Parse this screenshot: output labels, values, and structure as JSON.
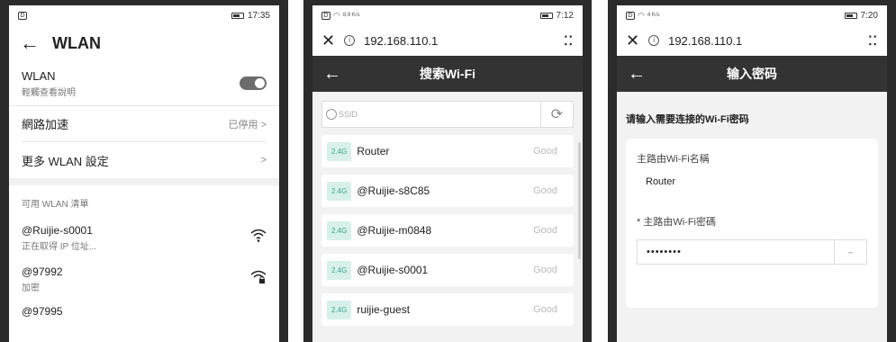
{
  "phone1": {
    "status": {
      "sim": "D",
      "time": "17:35"
    },
    "title": "WLAN",
    "wlan_row": {
      "label": "WLAN",
      "sub": "輕觸查看說明"
    },
    "accel_row": {
      "label": "網路加速",
      "value": "已停用",
      "chevron": ">"
    },
    "more_row": {
      "label": "更多 WLAN 設定",
      "chevron": ">"
    },
    "list_title": "可用 WLAN 清單",
    "networks": [
      {
        "name": "@Ruijie-s0001",
        "sub": "正在取得 IP 位址..."
      },
      {
        "name": "@97992",
        "sub": "加密"
      },
      {
        "name": "@97995",
        "sub": ""
      }
    ]
  },
  "phone2": {
    "status": {
      "sim": "D",
      "time": "7:12",
      "net": "8.9 K/s"
    },
    "url": "192.168.110.1",
    "menu": "⋮⋮",
    "page_title": "搜索Wi-Fi",
    "search_placeholder": "SSID",
    "aps": [
      {
        "band": "2.4G",
        "ssid": "Router",
        "quality": "Good"
      },
      {
        "band": "2.4G",
        "ssid": "@Ruijie-s8C85",
        "quality": "Good"
      },
      {
        "band": "2.4G",
        "ssid": "@Ruijie-m0848",
        "quality": "Good"
      },
      {
        "band": "2.4G",
        "ssid": "@Ruijie-s0001",
        "quality": "Good"
      },
      {
        "band": "2.4G",
        "ssid": "ruijie-guest",
        "quality": "Good"
      }
    ]
  },
  "phone3": {
    "status": {
      "sim": "D",
      "time": "7:20",
      "net": "4 K/s"
    },
    "url": "192.168.110.1",
    "page_title": "输入密码",
    "prompt": "请输入需要连接的Wi-Fi密码",
    "ssid_label": "主路由Wi-Fi名稱",
    "ssid_value": "Router",
    "password_label": "* 主路由Wi-Fi密碼",
    "password_value": "••••••••"
  }
}
